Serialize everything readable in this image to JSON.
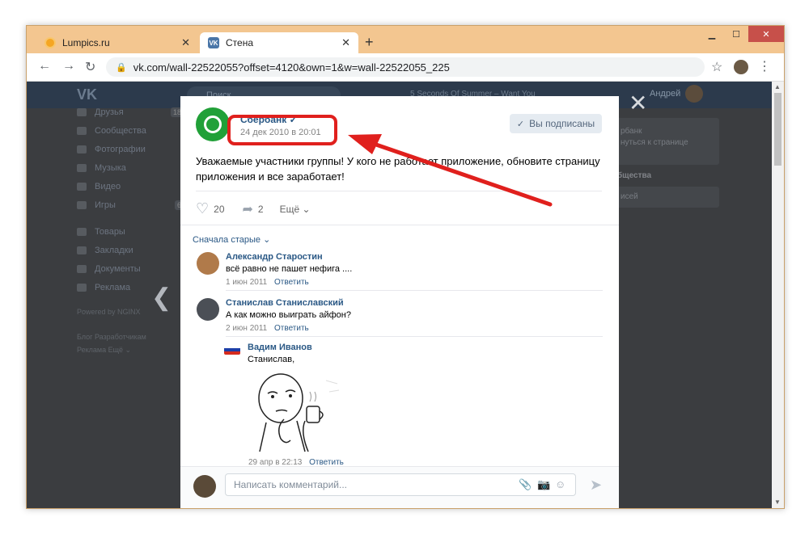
{
  "browser": {
    "tabs": [
      {
        "title": "Lumpics.ru",
        "favicon": "lumpics-icon",
        "active": false
      },
      {
        "title": "Стена",
        "favicon": "vk-icon",
        "active": true
      }
    ],
    "new_tab": "+",
    "controls": {
      "minimize": "▁",
      "maximize": "☐",
      "close": "✕"
    },
    "nav": {
      "back": "←",
      "forward": "→",
      "reload": "↻"
    },
    "url": "vk.com/wall-22522055?offset=4120&own=1&w=wall-22522055_225",
    "star": "☆",
    "menu": "⋮"
  },
  "vk_header": {
    "logo": "VK",
    "search_placeholder": "Поиск",
    "player_track": "5 Seconds Of Summer – Want You",
    "user_name": "Андрей"
  },
  "sidebar": {
    "items": [
      {
        "label": "Друзья",
        "count": "18"
      },
      {
        "label": "Сообщества",
        "count": ""
      },
      {
        "label": "Фотографии",
        "count": ""
      },
      {
        "label": "Музыка",
        "count": ""
      },
      {
        "label": "Видео",
        "count": ""
      },
      {
        "label": "Игры",
        "count": "6"
      }
    ],
    "items2": [
      {
        "label": "Товары"
      },
      {
        "label": "Закладки"
      },
      {
        "label": "Документы"
      },
      {
        "label": "Реклама"
      }
    ],
    "powered": "Powered by NGINX",
    "links_line1": "Блог  Разработчикам",
    "links_line2": "Реклама  Ещё ⌄"
  },
  "right_panel": {
    "card_line1": "рбанк",
    "card_line2": "нуться к странице",
    "heading": "бщества",
    "card2": "исей"
  },
  "post": {
    "author": "Сбербанк ✓",
    "date": "24 дек 2010 в 20:01",
    "subscribed_label": "Вы подписаны",
    "text": "Уважаемые участники группы! У кого не работает приложение, обновите страницу приложения и все заработает!",
    "likes": "20",
    "shares": "2",
    "more_label": "Ещё ⌄"
  },
  "comments": {
    "sort_label": "Сначала старые ⌄",
    "items": [
      {
        "name": "Александр Старостин",
        "text": "всё равно не пашет нефига ....",
        "date": "1 июн 2011",
        "reply": "Ответить"
      },
      {
        "name": "Станислав Станиславский",
        "text": "А как можно выиграть айфон?",
        "date": "2 июн 2011",
        "reply": "Ответить"
      }
    ],
    "reply_item": {
      "name": "Вадим Иванов",
      "text": "Станислав,",
      "date": "29 апр в 22:13",
      "reply": "Ответить"
    }
  },
  "composer": {
    "placeholder": "Написать комментарий..."
  },
  "colors": {
    "link": "#2a5885",
    "highlight": "#e0201d",
    "overlay": "#3b3d40",
    "vk_header": "#2c3a4c",
    "sber_green": "#21a038"
  }
}
